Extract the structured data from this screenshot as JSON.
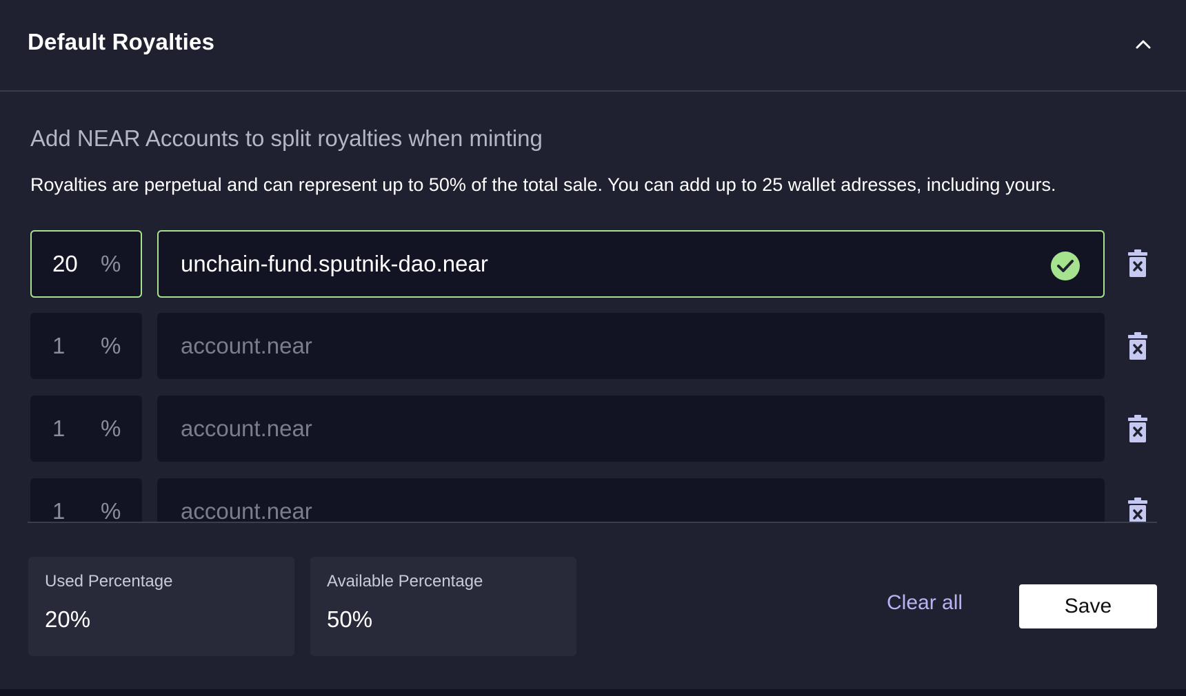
{
  "header": {
    "title": "Default Royalties",
    "collapse_icon": "chevron-up-icon"
  },
  "content": {
    "subtitle": "Add NEAR Accounts to split royalties when minting",
    "description": "Royalties are perpetual and can represent up to 50% of the total sale. You can add up to 25 wallet adresses, including yours."
  },
  "royalties": [
    {
      "percent": "20",
      "percent_sign": "%",
      "account": "unchain-fund.sputnik-dao.near",
      "placeholder": "account.near",
      "valid": true
    },
    {
      "percent": "1",
      "percent_sign": "%",
      "account": "",
      "placeholder": "account.near",
      "valid": false
    },
    {
      "percent": "1",
      "percent_sign": "%",
      "account": "",
      "placeholder": "account.near",
      "valid": false
    },
    {
      "percent": "1",
      "percent_sign": "%",
      "account": "",
      "placeholder": "account.near",
      "valid": false
    }
  ],
  "stats": {
    "used_label": "Used Percentage",
    "used_value": "20%",
    "available_label": "Available Percentage",
    "available_value": "50%"
  },
  "actions": {
    "clear_label": "Clear all",
    "save_label": "Save"
  },
  "colors": {
    "valid_accent": "#a6e38e",
    "link_accent": "#b7b4f5",
    "background": "#1f2130",
    "input_background": "#121424"
  }
}
